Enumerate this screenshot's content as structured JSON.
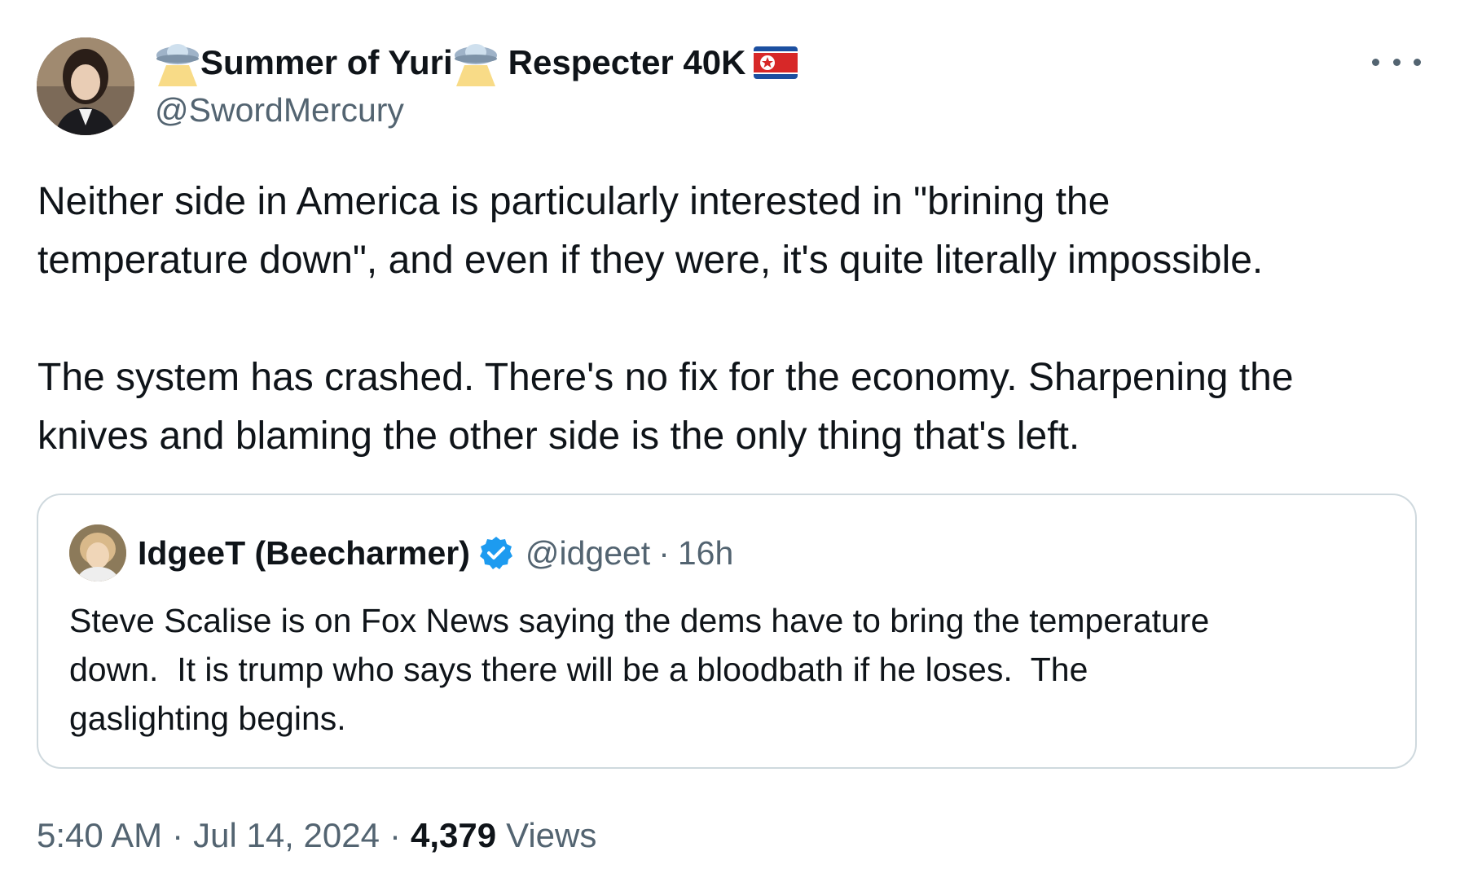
{
  "author": {
    "display_name_parts": [
      "Summer of Yuri",
      "Respecter 40K"
    ],
    "name_icon": "flying-saucer-icon",
    "flag_icon": "north-korea-flag-icon",
    "handle": "@SwordMercury",
    "avatar_icon": "profile-photo"
  },
  "more_icon": "more-options-icon",
  "tweet_text": {
    "paragraph1": [
      "Neither side in America is particularly interested in \"brining the",
      "temperature down\", and even if they were, it's quite literally impossible."
    ],
    "paragraph2": [
      "The system has crashed. There's no fix for the economy. Sharpening the",
      "knives and blaming the other side is the only thing that's left."
    ]
  },
  "quoted_tweet": {
    "display_name": "IdgeeT (Beecharmer)",
    "verified_icon": "verified-badge-icon",
    "handle": "@idgeet",
    "separator": "·",
    "time": "16h",
    "text_lines": [
      "Steve Scalise is on Fox News saying the dems have to bring the temperature",
      "down.  It is trump who says there will be a bloodbath if he loses.  The",
      "gaslighting begins."
    ]
  },
  "meta": {
    "time": "5:40 AM",
    "separator": "·",
    "date": "Jul 14, 2024",
    "views_count": "4,379",
    "views_label": "Views"
  },
  "colors": {
    "text_primary": "#0f1419",
    "text_secondary": "#536471",
    "border": "#cfd9de",
    "verified_blue": "#1d9bf0"
  }
}
